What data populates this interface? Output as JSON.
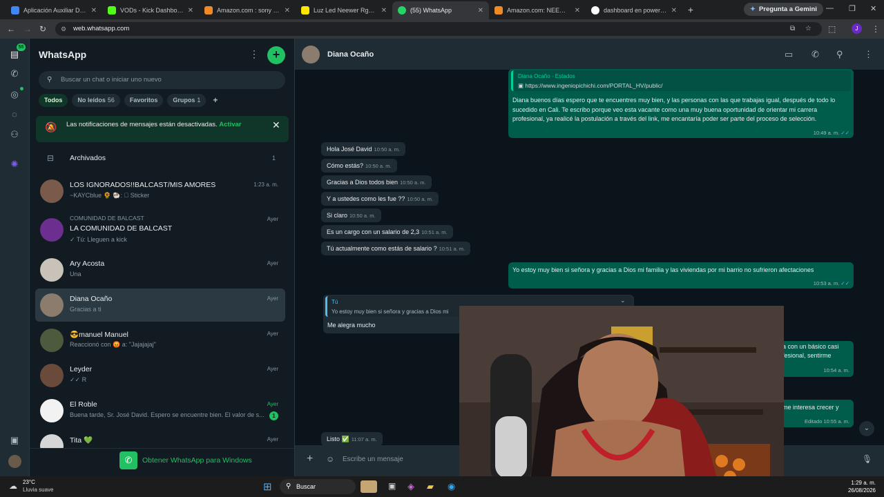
{
  "browser": {
    "tabs": [
      {
        "title": "Aplicación Auxiliar Desarro",
        "color": "#4285f4"
      },
      {
        "title": "VODs - Kick Dashboard",
        "color": "#53fc18"
      },
      {
        "title": "Amazon.com : sony zv e10",
        "color": "#f08a24"
      },
      {
        "title": "Luz Led Neewer Rgb | Mer",
        "color": "#ffe600"
      },
      {
        "title": "(55) WhatsApp",
        "color": "#25d366"
      },
      {
        "title": "Amazon.com: NEEWER RG",
        "color": "#f08a24"
      },
      {
        "title": "dashboard en power bi - E",
        "color": "#4285f4"
      }
    ],
    "gemini_label": "Pregunta a Gemini",
    "url": "web.whatsapp.com",
    "profile_initial": "J"
  },
  "rail": {
    "badge": "55"
  },
  "sidebar": {
    "title": "WhatsApp",
    "search_placeholder": "Buscar un chat o iniciar uno nuevo",
    "filters": [
      {
        "label": "Todos",
        "count": ""
      },
      {
        "label": "No leídos",
        "count": "56"
      },
      {
        "label": "Favoritos",
        "count": ""
      },
      {
        "label": "Grupos",
        "count": "1"
      }
    ],
    "notif_text": "Las notificaciones de mensajes están desactivadas.",
    "notif_action": "Activar",
    "archived_label": "Archivados",
    "archived_count": "1",
    "chats": [
      {
        "name": "LOS IGNORADOS!!BALCAST/MIS AMORES",
        "preview": "~KAYCblue 🌻 🐏: ⃞ Sticker",
        "time": "1:23 a. m.",
        "avatar": "#7a5a4a"
      },
      {
        "community": "COMUNIDAD DE BALCAST",
        "name": "LA COMUNIDAD DE BALCAST",
        "preview": "✓ Tú: Lleguen a kick",
        "time": "Ayer",
        "avatar": "#6c2f8f"
      },
      {
        "name": "Ary Acosta",
        "preview": "Una",
        "time": "Ayer",
        "avatar": "#c9c2b8"
      },
      {
        "name": "Diana Ocaño",
        "preview": "Gracias a ti",
        "time": "Ayer",
        "avatar": "#8b7c6e"
      },
      {
        "name": "😎manuel Manuel",
        "preview": "Reaccionó con 😡 a: \"Jajajajaj\"",
        "time": "Ayer",
        "avatar": "#4e5a3e"
      },
      {
        "name": "Leyder",
        "preview": "✓✓ R",
        "time": "Ayer",
        "avatar": "#6a4a3a"
      },
      {
        "name": "El Roble",
        "preview": "Buena tarde, Sr. José David. Espero se encuentre bien. El valor de s...",
        "time": "Ayer",
        "avatar": "#f2f2f2",
        "unread": "1"
      },
      {
        "name": "Tita 💚",
        "preview": "",
        "time": "Ayer",
        "avatar": "#d6d6d6"
      }
    ],
    "get_windows": "Obtener WhatsApp para Windows"
  },
  "conversation": {
    "contact": "Diana Ocaño",
    "status_reply": {
      "source": "Diana Ocaño · Estados",
      "link": "https://www.ingeniopichichi.com/PORTAL_HV/public/",
      "text": "Diana buenos días espero que te encuentres muy bien, y las personas con las que trabajas igual, después de todo lo sucedido en Cali. Te escribo porque veo esta vacante como una muy buena oportunidad de orientar mi carrera profesional, ya realicé la postulación a través del link, me encantaría poder ser parte del proceso de selección.",
      "time": "10:49 a. m."
    },
    "incoming": [
      {
        "text": "Hola José David",
        "time": "10:50 a. m."
      },
      {
        "text": "Cómo estás?",
        "time": "10:50 a. m."
      },
      {
        "text": "Gracias a Dios todos bien",
        "time": "10:50 a. m."
      },
      {
        "text": "Y a ustedes como les fue ??",
        "time": "10:50 a. m."
      },
      {
        "text": "Si claro",
        "time": "10:50 a. m."
      },
      {
        "text": "Es un cargo con un salario de 2,3",
        "time": "10:51 a. m."
      },
      {
        "text": "Tú actualmente como estás de salario ?",
        "time": "10:51 a. m."
      }
    ],
    "out_reply": {
      "text": "Yo estoy muy bien si señora y gracias a Dios mi familia y las viviendas por mi barrio no sufrieron afectaciones",
      "time": "10:53 a. m."
    },
    "quoted": {
      "author": "Tú",
      "text": "Yo estoy muy bien si señora y gracias a Dios mi",
      "reply": "Me alegra mucho"
    },
    "partial_out": [
      {
        "text": "a con un básico casi"
      },
      {
        "text": "fesional, sentirme"
      },
      {
        "time": "10:54 a. m."
      },
      {
        "text": "me interesa crecer y"
      },
      {
        "time": "Editado 10:55 a. m."
      }
    ],
    "last_in": {
      "text": "Listo ✅",
      "time": "11:07 a. m."
    },
    "composer_placeholder": "Escribe un mensaje"
  },
  "taskbar": {
    "temp": "23°C",
    "weather": "Lluvia suave",
    "search": "Buscar",
    "time": "1:29 a. m.",
    "date": "26/08/2026"
  }
}
